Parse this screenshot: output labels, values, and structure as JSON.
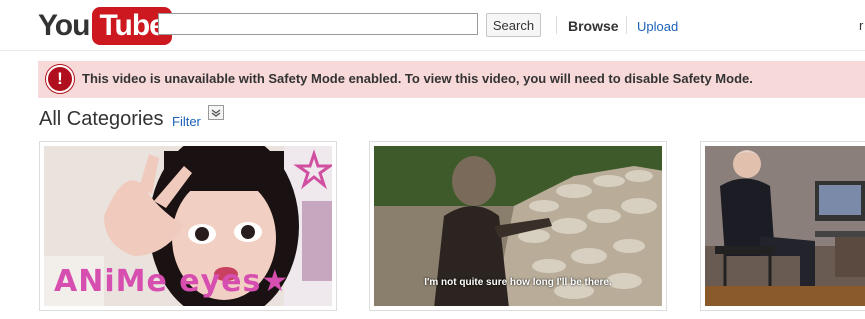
{
  "header": {
    "logo_you": "You",
    "logo_tube": "Tube",
    "search_placeholder": "",
    "search_button": "Search",
    "nav_browse": "Browse",
    "nav_upload": "Upload",
    "nav_user": "r"
  },
  "alert": {
    "icon": "!",
    "message": "This video is unavailable with Safety Mode enabled. To view this video, you will need to disable Safety Mode."
  },
  "categories": {
    "title": "All Categories",
    "filter_label": "Filter"
  },
  "thumbnails": [
    {
      "id": "anime-eyes",
      "overlay_text": "ANiMe eyes★"
    },
    {
      "id": "rock-wall",
      "subtitle": "I'm not quite sure how long I'll be there."
    },
    {
      "id": "interview",
      "overlay_text": ""
    }
  ],
  "colors": {
    "brand_red": "#cc181e",
    "link_blue": "#1c62b9",
    "alert_bg": "#f8d9d9"
  }
}
